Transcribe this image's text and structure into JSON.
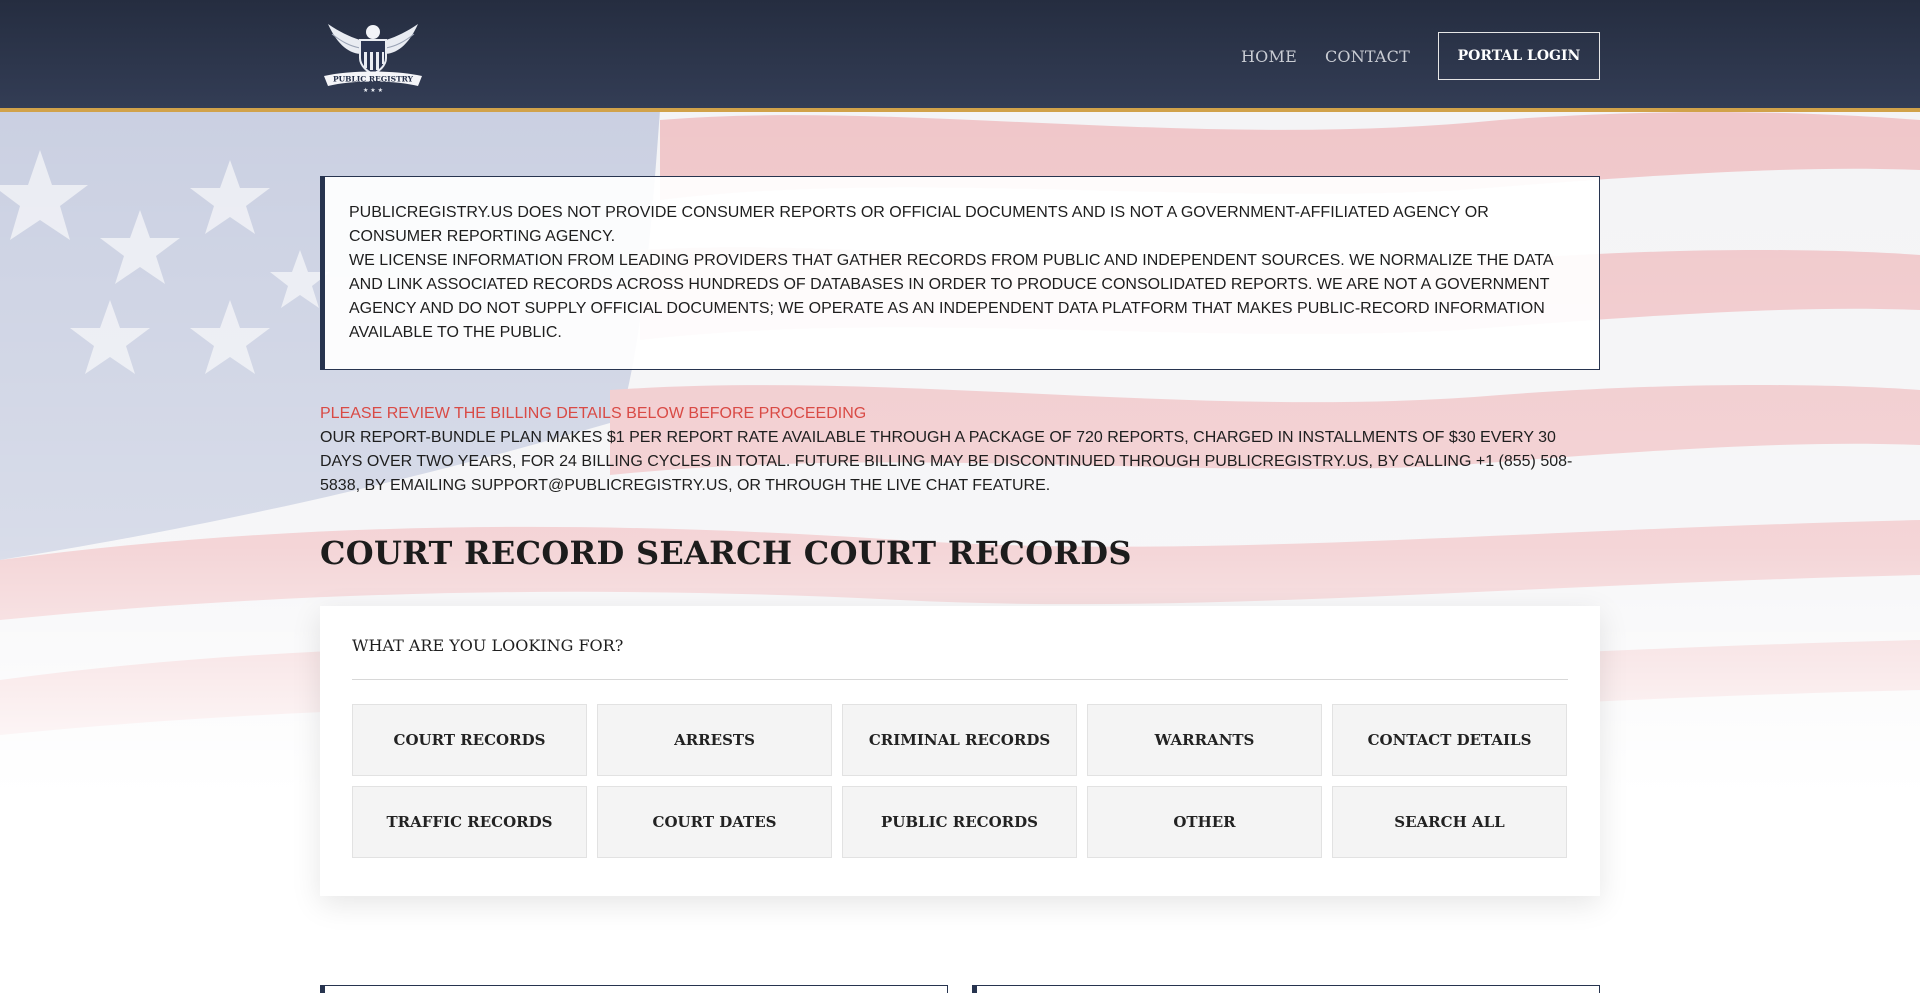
{
  "header": {
    "logo_text": "PUBLIC REGISTRY",
    "nav": [
      {
        "label": "HOME"
      },
      {
        "label": "CONTACT"
      }
    ],
    "portal_label": "PORTAL LOGIN"
  },
  "disclaimer": {
    "line1": "PUBLICREGISTRY.US DOES NOT PROVIDE CONSUMER REPORTS OR OFFICIAL DOCUMENTS AND IS NOT A GOVERNMENT-AFFILIATED AGENCY OR CONSUMER REPORTING AGENCY.",
    "line2": "WE LICENSE INFORMATION FROM LEADING PROVIDERS THAT GATHER RECORDS FROM PUBLIC AND INDEPENDENT SOURCES. WE NORMALIZE THE DATA AND LINK ASSOCIATED RECORDS ACROSS HUNDREDS OF DATABASES IN ORDER TO PRODUCE CONSOLIDATED REPORTS. WE ARE NOT A GOVERNMENT AGENCY AND DO NOT SUPPLY OFFICIAL DOCUMENTS; WE OPERATE AS AN INDEPENDENT DATA PLATFORM THAT MAKES PUBLIC-RECORD INFORMATION AVAILABLE TO THE PUBLIC."
  },
  "billing": {
    "warning": "PLEASE REVIEW THE BILLING DETAILS BELOW BEFORE PROCEEDING",
    "text": "OUR REPORT-BUNDLE PLAN MAKES $1 PER REPORT RATE AVAILABLE THROUGH A PACKAGE OF 720 REPORTS, CHARGED IN INSTALLMENTS OF $30 EVERY 30 DAYS OVER TWO YEARS, FOR 24 BILLING CYCLES IN TOTAL. FUTURE BILLING MAY BE DISCONTINUED THROUGH PUBLICREGISTRY.US, BY CALLING +1 (855) 508-5838, BY EMAILING SUPPORT@PUBLICREGISTRY.US, OR THROUGH THE LIVE CHAT FEATURE."
  },
  "page_title": "COURT RECORD SEARCH COURT RECORDS",
  "search_panel": {
    "title": "WHAT ARE YOU LOOKING FOR?",
    "options": [
      {
        "label": "COURT RECORDS"
      },
      {
        "label": "ARRESTS"
      },
      {
        "label": "CRIMINAL RECORDS"
      },
      {
        "label": "WARRANTS"
      },
      {
        "label": "CONTACT DETAILS"
      },
      {
        "label": "TRAFFIC RECORDS"
      },
      {
        "label": "COURT DATES"
      },
      {
        "label": "PUBLIC RECORDS"
      },
      {
        "label": "OTHER"
      },
      {
        "label": "SEARCH ALL"
      }
    ]
  },
  "colors": {
    "header_bg": "#2b3448",
    "header_border": "#d1a24a",
    "warning": "#d94a45",
    "accent_border": "#27344f"
  }
}
